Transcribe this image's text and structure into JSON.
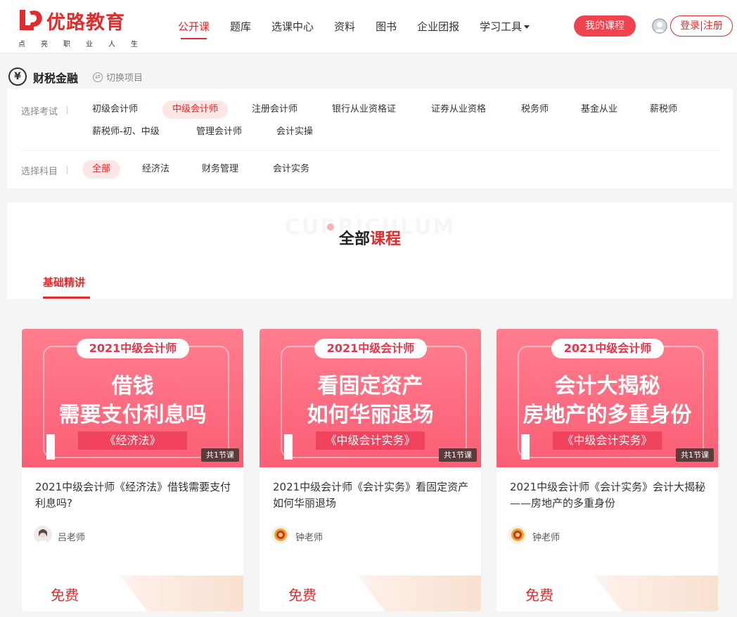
{
  "header": {
    "logo_text": "优路教育",
    "logo_slogan": [
      "点",
      "亮",
      "职",
      "业",
      "人",
      "生"
    ],
    "nav": [
      "公开课",
      "题库",
      "选课中心",
      "资料",
      "图书",
      "企业团报",
      "学习工具"
    ],
    "my_course": "我的课程",
    "login": "登录",
    "separator": "|",
    "register": "注册"
  },
  "category": {
    "icon_glyph": "¥",
    "title": "财税金融",
    "switch": "切换项目"
  },
  "filters": {
    "exam_label": "选择考试",
    "exams": [
      "初级会计师",
      "中级会计师",
      "注册会计师",
      "银行从业资格证",
      "证券从业资格",
      "税务师",
      "基金从业",
      "薪税师",
      "薪税师-初、中级",
      "管理会计师",
      "会计实操"
    ],
    "exam_selected": "中级会计师",
    "subject_label": "选择科目",
    "subjects": [
      "全部",
      "经济法",
      "财务管理",
      "会计实务"
    ],
    "subject_selected": "全部"
  },
  "section": {
    "bg_word": "CURRICULUM",
    "title_a": "全部",
    "title_b": "课程",
    "tab": "基础精讲"
  },
  "courses": [
    {
      "pill": "2021中级会计师",
      "line1": "借钱",
      "line2": "需要支付利息吗",
      "subject": "《经济法》",
      "lessons": "共1节课",
      "title": "2021中级会计师《经济法》借钱需要支付利息吗?",
      "teacher": "吕老师",
      "price": "免费"
    },
    {
      "pill": "2021中级会计师",
      "line1": "看固定资产",
      "line2": "如何华丽退场",
      "subject": "《中级会计实务》",
      "lessons": "共1节课",
      "title": "2021中级会计师《会计实务》看固定资产如何华丽退场",
      "teacher": "钟老师",
      "price": "免费"
    },
    {
      "pill": "2021中级会计师",
      "line1": "会计大揭秘",
      "line2": "房地产的多重身份",
      "subject": "《中级会计实务》",
      "lessons": "共1节课",
      "title": "2021中级会计师《会计实务》会计大揭秘——房地产的多重身份",
      "teacher": "钟老师",
      "price": "免费"
    }
  ],
  "colors": {
    "brand_red": "#e02c2c",
    "button_red": "#f0434f",
    "banner_pink": "#fb5e75"
  }
}
